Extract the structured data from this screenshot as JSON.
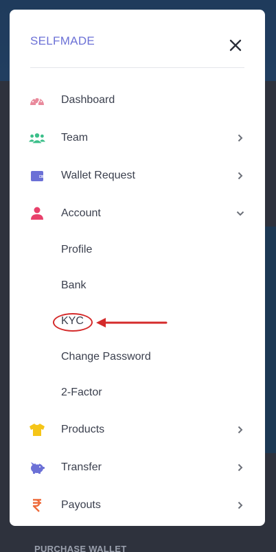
{
  "brand": "SELFMADE",
  "menu": {
    "dashboard": "Dashboard",
    "team": "Team",
    "wallet_request": "Wallet Request",
    "account": "Account",
    "products": "Products",
    "transfer": "Transfer",
    "payouts": "Payouts"
  },
  "account_submenu": {
    "profile": "Profile",
    "bank": "Bank",
    "kyc": "KYC",
    "change_password": "Change Password",
    "two_factor": "2-Factor"
  },
  "background": {
    "bottom_text": "PURCHASE WALLET"
  },
  "icons": {
    "dashboard": "gauge-icon",
    "team": "users-icon",
    "wallet_request": "wallet-icon",
    "account": "user-icon",
    "products": "tshirt-icon",
    "transfer": "piggy-bank-icon",
    "payouts": "rupee-icon",
    "close": "close-icon"
  },
  "colors": {
    "brand": "#6b70d6",
    "dashboard_icon": "#e98a9c",
    "team_icon": "#3cbf8a",
    "wallet_icon": "#6b70d6",
    "account_icon": "#e8416b",
    "products_icon": "#f5c518",
    "transfer_icon": "#6b70d6",
    "payouts_icon": "#ee6a3a",
    "annotation": "#d42a2a"
  }
}
